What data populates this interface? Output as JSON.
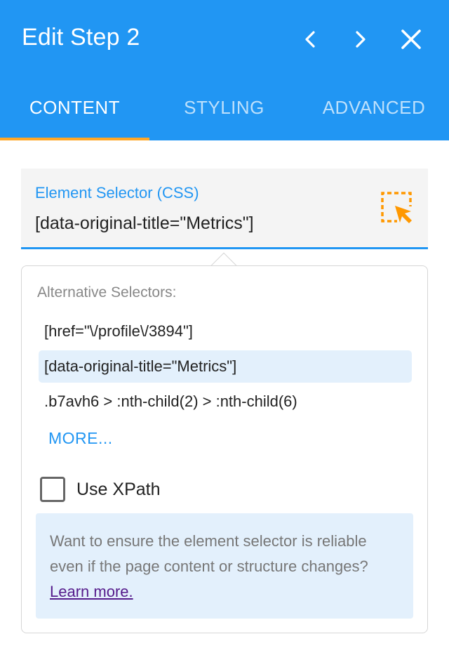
{
  "header": {
    "title": "Edit Step 2",
    "prev_icon": "chevron-left-icon",
    "next_icon": "chevron-right-icon",
    "close_icon": "close-icon",
    "background": "#2196f3"
  },
  "tabs": [
    {
      "label": "CONTENT",
      "active": true
    },
    {
      "label": "STYLING",
      "active": false
    },
    {
      "label": "ADVANCED",
      "active": false
    }
  ],
  "tab_indicator_color": "#ffa726",
  "selector_field": {
    "label": "Element Selector (CSS)",
    "value": "[data-original-title=\"Metrics\"]",
    "picker_icon": "element-picker-icon",
    "picker_color": "#ff9800"
  },
  "alternatives": {
    "label": "Alternative Selectors:",
    "items": [
      {
        "text": "[href=\"\\/profile\\/3894\"]",
        "selected": false
      },
      {
        "text": "[data-original-title=\"Metrics\"]",
        "selected": true
      },
      {
        "text": ".b7avh6 > :nth-child(2) > :nth-child(6)",
        "selected": false
      }
    ],
    "more_label": "MORE..."
  },
  "use_xpath": {
    "label": "Use XPath",
    "checked": false
  },
  "info": {
    "text": "Want to ensure the element selector is reliable even if the page content or structure changes?",
    "link": "Learn more."
  }
}
